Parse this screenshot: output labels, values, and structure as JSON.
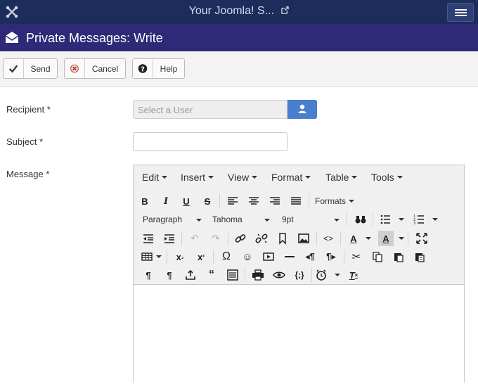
{
  "topbar": {
    "site_name": "Your Joomla! S...",
    "colors": {
      "bar": "#1c2c5b"
    }
  },
  "titlebar": {
    "title": "Private Messages: Write",
    "icon": "envelope-icon"
  },
  "toolbar": {
    "send": "Send",
    "cancel": "Cancel",
    "help": "Help"
  },
  "form": {
    "recipient_label": "Recipient *",
    "recipient_placeholder": "Select a User",
    "subject_label": "Subject *",
    "subject_value": "",
    "message_label": "Message *"
  },
  "editor": {
    "menus": [
      "Edit",
      "Insert",
      "View",
      "Format",
      "Table",
      "Tools"
    ],
    "formats_label": "Formats",
    "paragraph_select": "Paragraph",
    "font_select": "Tahoma",
    "size_select": "9pt"
  }
}
